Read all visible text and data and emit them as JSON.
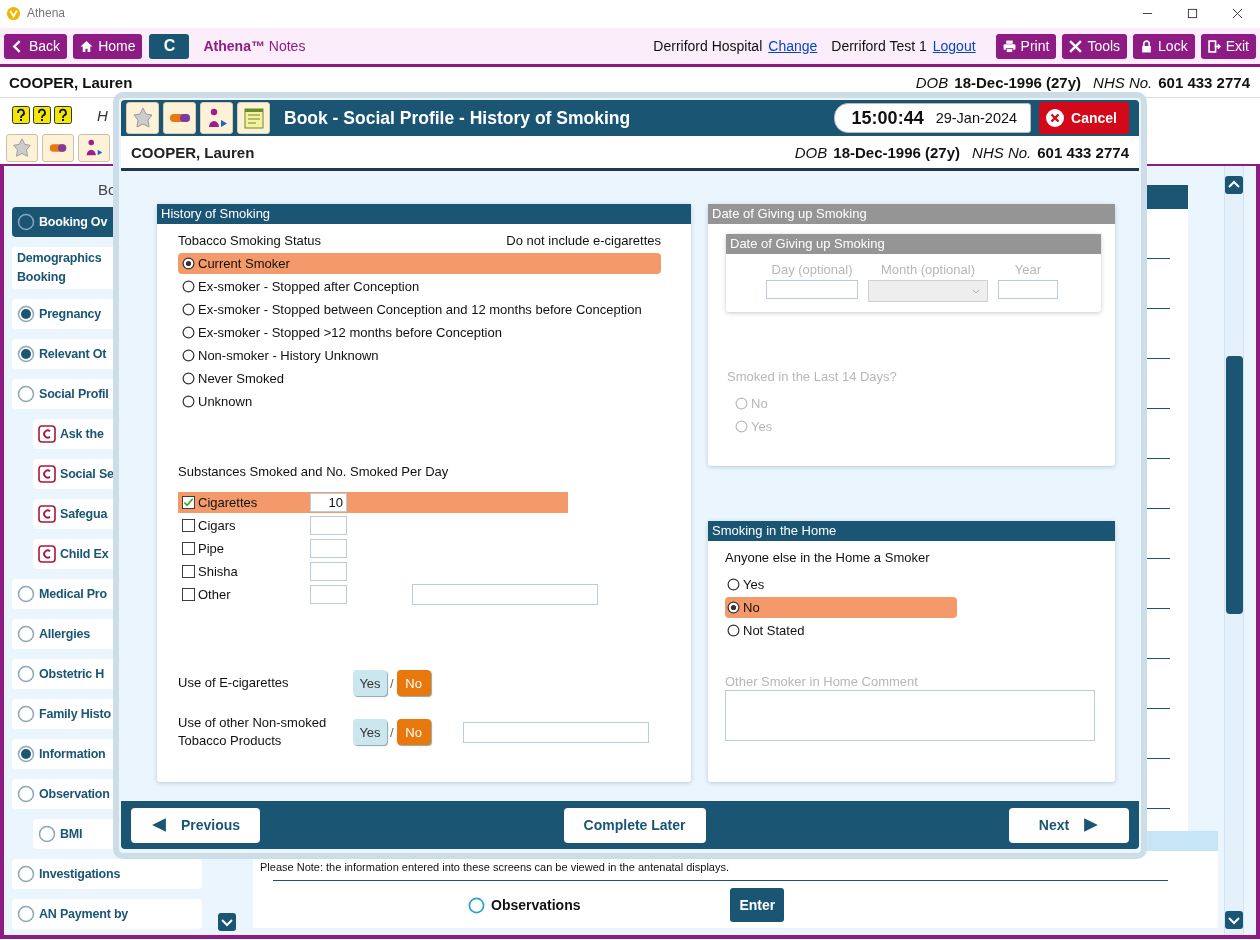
{
  "window": {
    "title": "Athena"
  },
  "toolbar": {
    "left_buttons": [
      "Back",
      "Home"
    ],
    "c_button": "C",
    "app_title": "**Athena™** Notes",
    "location": "Derriford Hospital",
    "location_link": "Change",
    "user": "Derriford Test 1",
    "user_link": "Logout",
    "right_buttons": [
      "Print",
      "Tools",
      "Lock",
      "Exit"
    ]
  },
  "patient": {
    "name": "COOPER, Lauren",
    "dob_label": "DOB",
    "dob": "18-Dec-1996 (27y)",
    "nhs_label": "NHS No.",
    "nhs": "601 433 2774"
  },
  "subheader": {
    "text": "H"
  },
  "sidebar": {
    "heading": "Bo",
    "items": [
      {
        "label": "Booking Ov",
        "kind": "radio",
        "checked": false,
        "selected": true
      },
      {
        "label": "Demographics Booking",
        "kind": "plain",
        "selected": false
      },
      {
        "label": "Pregnancy",
        "kind": "radio",
        "checked": true,
        "selected": false
      },
      {
        "label": "Relevant Ot",
        "kind": "radio",
        "checked": true,
        "selected": false
      },
      {
        "label": "Social Profil",
        "kind": "radio",
        "checked": false,
        "selected": false,
        "children": [
          {
            "label": "Ask the",
            "kind": "c",
            "selected": false
          },
          {
            "label": "Social Se",
            "kind": "c",
            "selected": false
          },
          {
            "label": "Safegua",
            "kind": "c",
            "selected": false
          },
          {
            "label": "Child Ex",
            "kind": "c",
            "selected": false
          }
        ]
      },
      {
        "label": "Medical Pro",
        "kind": "radio",
        "checked": false,
        "selected": false
      },
      {
        "label": "Allergies",
        "kind": "radio",
        "checked": false,
        "selected": false
      },
      {
        "label": "Obstetric H",
        "kind": "radio",
        "checked": false,
        "selected": false
      },
      {
        "label": "Family Histo",
        "kind": "radio",
        "checked": false,
        "selected": false
      },
      {
        "label": "Information",
        "kind": "radio",
        "checked": true,
        "selected": false
      },
      {
        "label": "Observation",
        "kind": "radio",
        "checked": false,
        "selected": false,
        "children": [
          {
            "label": "BMI",
            "kind": "radio",
            "checked": false,
            "selected": false
          }
        ]
      },
      {
        "label": "Investigations",
        "kind": "radio",
        "checked": false,
        "selected": false
      },
      {
        "label": "AN Payment by",
        "kind": "radio",
        "checked": false,
        "selected": false
      }
    ]
  },
  "content": {
    "note": "Please Note: the information entered into these screens can be viewed in the antenatal displays.",
    "option": {
      "label": "Observations",
      "checked": false
    },
    "enter": "Enter"
  },
  "dialog": {
    "title": "Book - Social Profile - History of Smoking",
    "time": "15:00:44",
    "date": "29-Jan-2024",
    "cancel": "Cancel",
    "patient": {
      "name": "COOPER, Lauren",
      "dob_label": "DOB",
      "dob": "18-Dec-1996 (27y)",
      "nhs_label": "NHS No.",
      "nhs": "601 433 2774"
    },
    "history": {
      "title": "History of Smoking",
      "status_label": "Tobacco Smoking Status",
      "status_note": "Do not include e-cigarettes",
      "status_options": [
        {
          "label": "Current Smoker",
          "selected": true
        },
        {
          "label": "Ex-smoker - Stopped after Conception",
          "selected": false
        },
        {
          "label": "Ex-smoker - Stopped between Conception and 12 months before Conception",
          "selected": false
        },
        {
          "label": "Ex-smoker - Stopped >12 months before Conception",
          "selected": false
        },
        {
          "label": "Non-smoker - History Unknown",
          "selected": false
        },
        {
          "label": "Never Smoked",
          "selected": false
        },
        {
          "label": "Unknown",
          "selected": false
        }
      ],
      "substances_label": "Substances Smoked and No. Smoked Per Day",
      "substances": [
        {
          "label": "Cigarettes",
          "checked": true,
          "value": "10",
          "kind": "plain"
        },
        {
          "label": "Cigars",
          "checked": false,
          "kind": "plain"
        },
        {
          "label": "Pipe",
          "checked": false,
          "kind": "plain"
        },
        {
          "label": "Shisha",
          "checked": false,
          "kind": "plain"
        },
        {
          "label": "Other",
          "checked": false,
          "kind": "detail"
        }
      ],
      "questions": [
        {
          "label": "Use of E-cigarettes",
          "kind": "toggle",
          "separator": "/",
          "options": [
            {
              "label": "Yes",
              "selected": false
            },
            {
              "label": "No",
              "selected": true
            }
          ]
        },
        {
          "label": "Use of other Non-smoked Tobacco Products",
          "kind": "toggle_field",
          "separator": "/",
          "options": [
            {
              "label": "Yes",
              "selected": false
            },
            {
              "label": "No",
              "selected": true
            }
          ]
        }
      ]
    },
    "giving_up": {
      "disabled": true,
      "title": "Date of Giving up Smoking",
      "inner_title": "Date of Giving up Smoking",
      "day_label": "Day (optional)",
      "month_label": "Month (optional)",
      "year_label": "Year",
      "smoked_label": "Smoked in the Last 14 Days?",
      "smoked_options": [
        {
          "label": "No",
          "selected": false
        },
        {
          "label": "Yes",
          "selected": false
        }
      ]
    },
    "home": {
      "title": "Smoking in the Home",
      "question": "Anyone else in the Home a Smoker",
      "options": [
        {
          "label": "Yes",
          "selected": false
        },
        {
          "label": "No",
          "selected": true
        },
        {
          "label": "Not Stated",
          "selected": false
        }
      ],
      "comment_label": "Other Smoker in Home Comment"
    },
    "footer": {
      "previous": "Previous",
      "complete_later": "Complete Later",
      "next": "Next"
    }
  }
}
